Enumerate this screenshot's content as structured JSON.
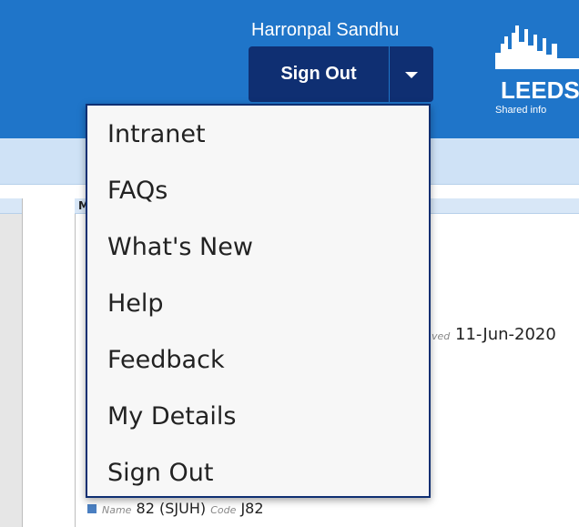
{
  "header": {
    "user_name": "Harronpal Sandhu",
    "sign_out_label": "Sign Out",
    "logo_text": "LEEDS",
    "logo_subtext": "Shared info"
  },
  "background": {
    "column_letter": "M",
    "approved_label": "ved",
    "approved_value": "11-Jun-2020",
    "name_label": "Name",
    "name_value": "82 (SJUH)",
    "code_label": "Code",
    "code_value": "J82"
  },
  "menu": {
    "items": [
      {
        "label": "Intranet"
      },
      {
        "label": "FAQs"
      },
      {
        "label": "What's New"
      },
      {
        "label": "Help"
      },
      {
        "label": "Feedback"
      },
      {
        "label": "My Details"
      },
      {
        "label": "Sign Out"
      }
    ]
  },
  "colors": {
    "header_bg": "#1f75c9",
    "button_bg": "#0f2f72",
    "band_bg": "#cfe2f6"
  }
}
